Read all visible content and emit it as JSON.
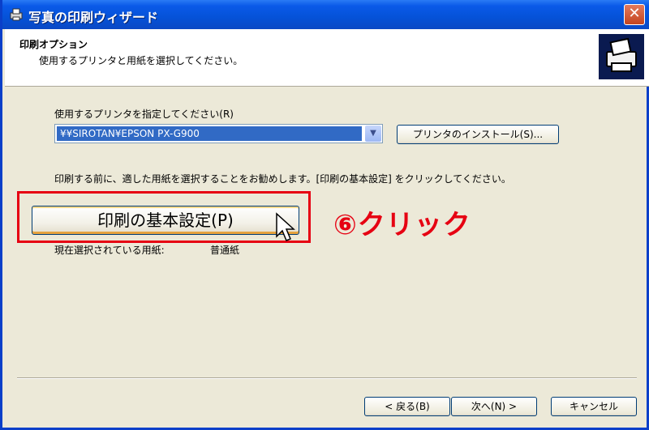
{
  "window": {
    "title": "写真の印刷ウィザード",
    "close_label": "✕"
  },
  "header": {
    "title": "印刷オプション",
    "subtitle": "使用するプリンタと用紙を選択してください。"
  },
  "printer": {
    "label": "使用するプリンタを指定してください(R)",
    "selected": "¥¥SIROTAN¥EPSON PX-G900",
    "install_button": "プリンタのインストール(S)..."
  },
  "instruction": "印刷する前に、適した用紙を選択することをお勧めします。[印刷の基本設定] をクリックしてください。",
  "preferences_button": "印刷の基本設定(P)",
  "annotation": "⑥クリック",
  "paper": {
    "label": "現在選択されている用紙:",
    "value": "普通紙"
  },
  "footer": {
    "back_button": "< 戻る(B)",
    "next_button": "次へ(N) >",
    "cancel_button": "キャンセル"
  },
  "colors": {
    "highlight": "#e60012",
    "titlebar": "#0552d8",
    "selection": "#316ac5"
  },
  "icons": {
    "title": "printer-wizard-icon",
    "header": "printer-icon",
    "combo": "chevron-down-icon",
    "pointer": "cursor-pointer-icon"
  }
}
